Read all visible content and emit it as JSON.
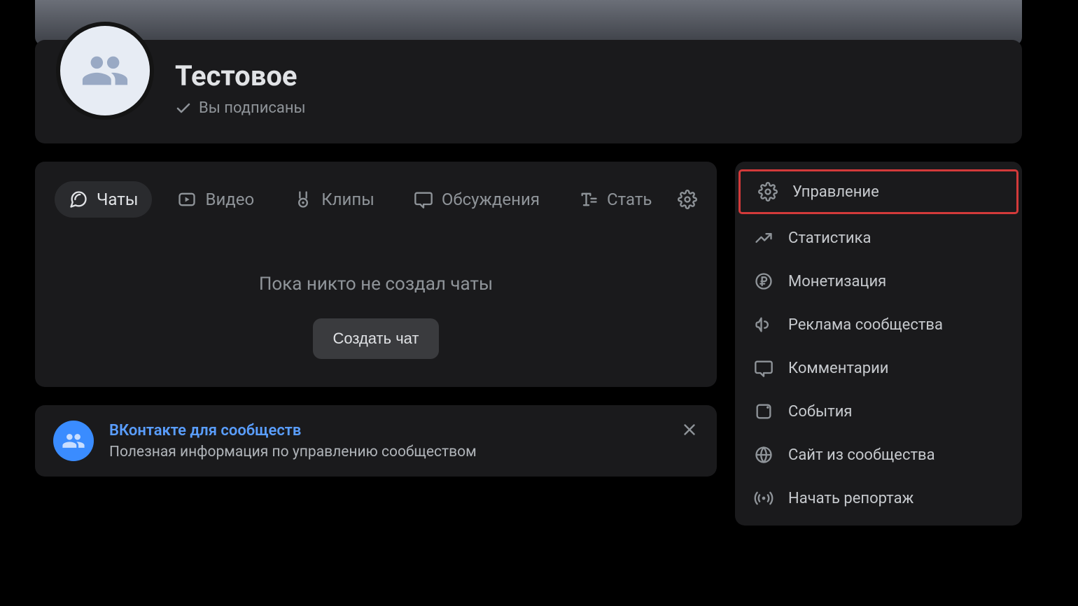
{
  "header": {
    "title": "Тестовое",
    "subscribed_label": "Вы подписаны"
  },
  "tabs": {
    "chats": "Чаты",
    "video": "Видео",
    "clips": "Клипы",
    "discussions": "Обсуждения",
    "articles": "Стать"
  },
  "empty": {
    "message": "Пока никто не создал чаты",
    "button": "Создать чат"
  },
  "promo": {
    "title": "ВКонтакте для сообществ",
    "subtitle": "Полезная информация по управлению сообществом"
  },
  "sidebar": {
    "manage": "Управление",
    "stats": "Статистика",
    "monetization": "Монетизация",
    "ads": "Реклама сообщества",
    "comments": "Комментарии",
    "events": "События",
    "site": "Сайт из сообщества",
    "live": "Начать репортаж"
  }
}
